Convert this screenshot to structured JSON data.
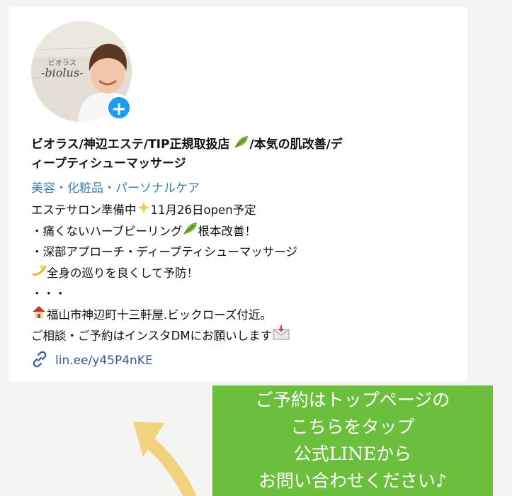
{
  "profile": {
    "avatar_text_top": "ビオラス",
    "avatar_text_script": "-biolus-",
    "add_symbol": "+",
    "name_line1": "ビオラス/神辺エステ/TIP正規取扱店",
    "name_line1_tail": "/本気の肌改善/デ",
    "name_line2": "ィープティシューマッサージ",
    "category": "美容・化粧品・パーソナルケア"
  },
  "bio": {
    "line1_a": "エステサロン準備中",
    "line1_b": "11月26日open予定",
    "line2_a": "・痛くないハーブピーリング",
    "line2_b": "根本改善！",
    "line3": "・深部アプローチ・ディープティシューマッサージ",
    "line4": "全身の巡りを良くして予防！",
    "line5": "・・・",
    "line6": "福山市神辺町十三軒屋.ビックローズ付近。",
    "line7": "ご相談・ご予約はインスタDMにお願いします"
  },
  "link": {
    "text": "lin.ee/y45P4nKE"
  },
  "callout": {
    "line1": "ご予約はトップページの",
    "line2": "こちらをタップ",
    "line3": "公式LINEから",
    "line4": "お問い合わせください♪"
  },
  "colors": {
    "category_text": "#3a7fb8",
    "link_text": "#385898",
    "callout_bg": "#6bbf3c",
    "add_button": "#1d9bf0",
    "arrow": "#f3d27e"
  },
  "icons": [
    "plus-icon",
    "herb-icon",
    "sparkles-icon",
    "dizzy-icon",
    "house-icon",
    "envelope-icon",
    "link-icon",
    "arrow-icon"
  ]
}
